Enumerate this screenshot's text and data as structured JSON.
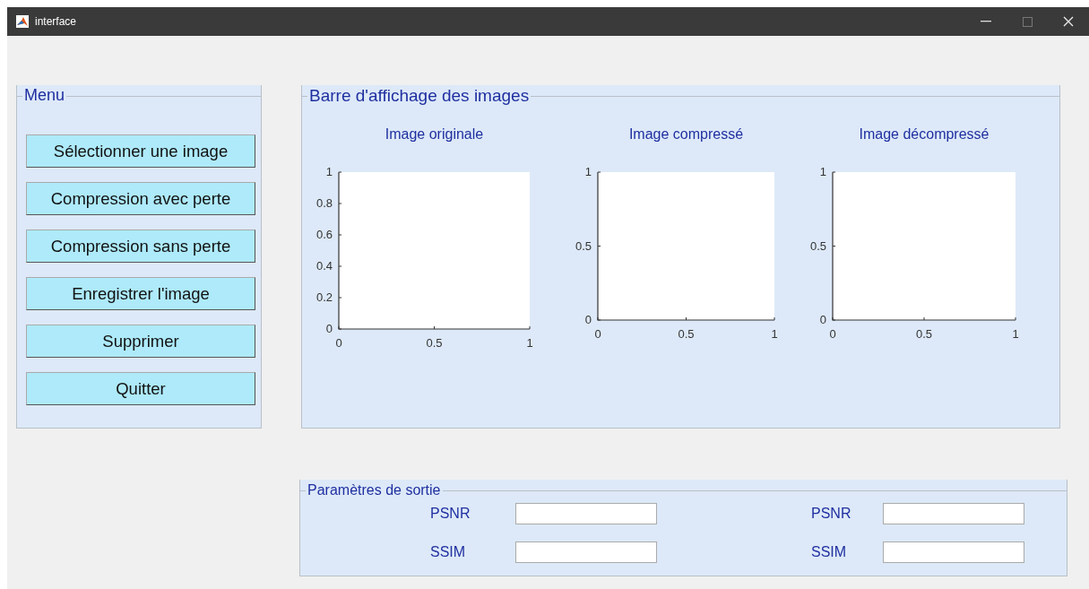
{
  "window": {
    "title": "interface"
  },
  "menu": {
    "title": "Menu",
    "buttons": [
      "Sélectionner une image",
      "Compression avec perte",
      "Compression sans perte",
      "Enregistrer l'image",
      "Supprimer",
      "Quitter"
    ]
  },
  "image_panel": {
    "title": "Barre d'affichage des images",
    "plots": [
      {
        "chart_data": {
          "type": "line",
          "title": "Image originale",
          "xlim": [
            0,
            1
          ],
          "ylim": [
            0,
            1
          ],
          "xticks": [
            0,
            0.5,
            1
          ],
          "yticks": [
            0,
            0.2,
            0.4,
            0.6,
            0.8,
            1
          ]
        }
      },
      {
        "chart_data": {
          "type": "line",
          "title": "Image compressé",
          "xlim": [
            0,
            1
          ],
          "ylim": [
            0,
            1
          ],
          "xticks": [
            0,
            0.5,
            1
          ],
          "yticks": [
            0,
            0.5,
            1
          ]
        }
      },
      {
        "chart_data": {
          "type": "line",
          "title": "Image décompressé",
          "xlim": [
            0,
            1
          ],
          "ylim": [
            0,
            1
          ],
          "xticks": [
            0,
            0.5,
            1
          ],
          "yticks": [
            0,
            0.5,
            1
          ]
        }
      }
    ]
  },
  "output_panel": {
    "title": "Paramètres de sortie",
    "fields": [
      {
        "label": "PSNR"
      },
      {
        "label": "PSNR"
      },
      {
        "label": "SSIM"
      },
      {
        "label": "SSIM"
      }
    ]
  }
}
